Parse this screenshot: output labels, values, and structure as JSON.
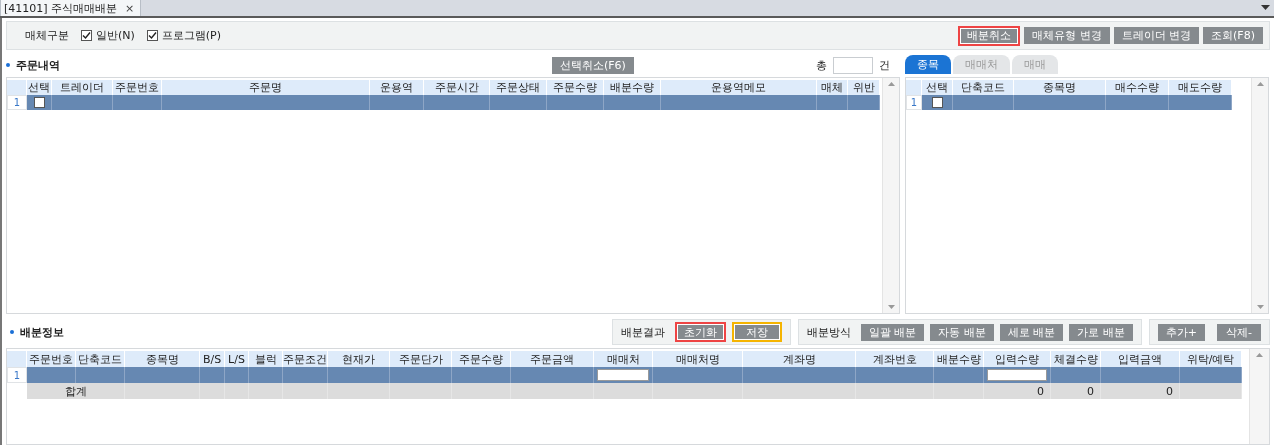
{
  "tab": {
    "title": "[41101] 주식매매배분",
    "close": "×"
  },
  "filter": {
    "label": "매체구분",
    "options": [
      {
        "label": "일반(N)",
        "checked": true
      },
      {
        "label": "프로그램(P)",
        "checked": true
      }
    ],
    "buttons": [
      {
        "label": "배분취소",
        "color": "#ee4444"
      },
      {
        "label": "매체유형 변경"
      },
      {
        "label": "트레이더 변경"
      },
      {
        "label": "조회(F8)"
      }
    ]
  },
  "orders": {
    "title": "주문내역",
    "cancel_button": "선택취소(F6)",
    "total_label": "총",
    "count_unit": "건",
    "columns": [
      "선택",
      "트레이더",
      "주문번호",
      "주문명",
      "운용역",
      "주문시간",
      "주문상태",
      "주문수량",
      "배분수량",
      "운용역메모",
      "매체",
      "위반"
    ],
    "rows": [
      {
        "number": "1",
        "checked": false,
        "selected": true
      }
    ]
  },
  "stocks": {
    "tabs": [
      {
        "label": "종목",
        "selected": true
      },
      {
        "label": "매매처",
        "selected": false
      },
      {
        "label": "매매",
        "selected": false
      }
    ],
    "columns": [
      "선택",
      "단축코드",
      "종목명",
      "매수수량",
      "매도수량"
    ],
    "rows": [
      {
        "number": "1",
        "checked": false,
        "selected": true
      }
    ]
  },
  "allocation": {
    "title": "배분정보",
    "result": {
      "label": "배분결과",
      "buttons": [
        {
          "label": "초기화",
          "color": "#ee4444"
        },
        {
          "label": "저장",
          "color": "#f5b400"
        }
      ]
    },
    "method": {
      "label": "배분방식",
      "buttons": [
        "일괄 배분",
        "자동 배분",
        "세로 배분",
        "가로 배분"
      ]
    },
    "edit_buttons": [
      "추가+",
      "삭제-"
    ],
    "columns": [
      {
        "label": "주문번호"
      },
      {
        "label": "단축코드"
      },
      {
        "label": "종목명"
      },
      {
        "label": "B/S"
      },
      {
        "label": "L/S"
      },
      {
        "label": "블럭"
      },
      {
        "label": "주문조건"
      },
      {
        "label": "현재가"
      },
      {
        "label": "주문단가"
      },
      {
        "label": "주문수량"
      },
      {
        "label": "주문금액"
      },
      {
        "label": "매매처"
      },
      {
        "label": "매매처명"
      },
      {
        "label": "계좌명"
      },
      {
        "label": "계좌번호"
      },
      {
        "label": "배분수량"
      },
      {
        "label": "입력수량",
        "total": "0"
      },
      {
        "label": "체결수량",
        "total": "0"
      },
      {
        "label": "입력금액",
        "total": "0"
      },
      {
        "label": "위탁/예탁"
      }
    ],
    "rows": [
      {
        "number": "1",
        "selected": true
      }
    ],
    "total_label": "합계"
  }
}
